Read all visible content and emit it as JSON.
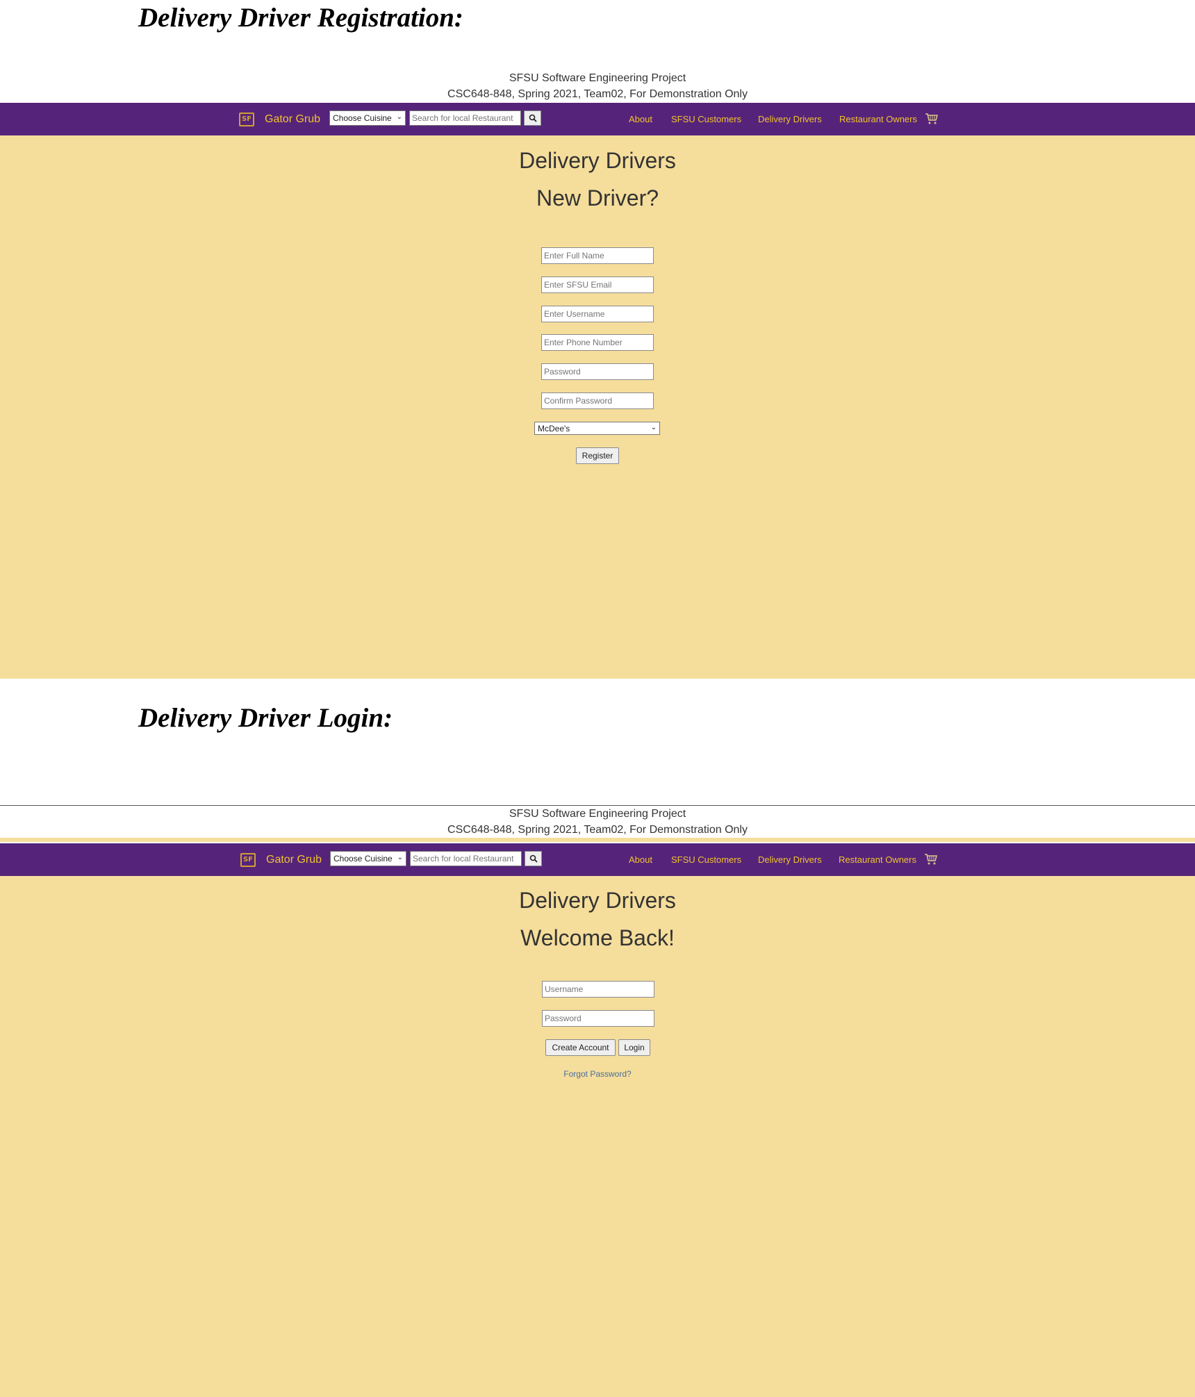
{
  "registration": {
    "section_heading": "Delivery Driver Registration:",
    "header": {
      "line1": "SFSU Software Engineering Project",
      "line2": "CSC648-848, Spring 2021, Team02, For Demonstration Only"
    },
    "nav": {
      "brand": "Gator Grub",
      "cuisine_select": "Choose Cuisine",
      "search_placeholder": "Search for local Restaurant",
      "links": [
        "About",
        "SFSU Customers",
        "Delivery Drivers",
        "Restaurant Owners"
      ]
    },
    "title": "Delivery Drivers",
    "subtitle": "New Driver?",
    "fields": {
      "full_name": "Enter Full Name",
      "email": "Enter SFSU Email",
      "username": "Enter Username",
      "phone": "Enter Phone Number",
      "password": "Password",
      "confirm_password": "Confirm Password"
    },
    "restaurant_select": "McDee's",
    "register_label": "Register"
  },
  "login": {
    "section_heading": "Delivery Driver Login:",
    "header": {
      "line1": "SFSU Software Engineering Project",
      "line2": "CSC648-848, Spring 2021, Team02, For Demonstration Only"
    },
    "nav": {
      "brand": "Gator Grub",
      "cuisine_select": "Choose Cuisine",
      "search_placeholder": "Search for local Restaurant",
      "links": [
        "About",
        "SFSU Customers",
        "Delivery Drivers",
        "Restaurant Owners"
      ]
    },
    "title": "Delivery Drivers",
    "subtitle": "Welcome Back!",
    "fields": {
      "username": "Username",
      "password": "Password"
    },
    "create_account_label": "Create Account",
    "login_label": "Login",
    "forgot_password": "Forgot Password?"
  },
  "colors": {
    "navbar": "#55247a",
    "nav_text": "#f2c230",
    "page_background": "#f5dd9b"
  },
  "icons": [
    "logo-icon",
    "search-icon",
    "cart-icon",
    "chevron-down-icon"
  ]
}
